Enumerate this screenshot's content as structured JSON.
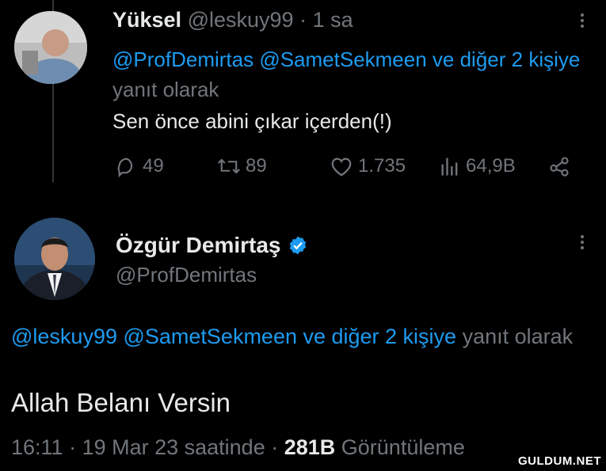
{
  "tweet1": {
    "name": "Yüksel",
    "handle": "@leskuy99",
    "separator": "·",
    "time": "1 sa",
    "replying_mentions": "@ProfDemirtas @SametSekmeen ve diğer 2 kişiye",
    "replying_suffix": "yanıt olarak",
    "body": "Sen önce abini çıkar içerden(!)",
    "replies": "49",
    "retweets": "89",
    "likes": "1.735",
    "views": "64,9B"
  },
  "tweet2": {
    "name": "Özgür Demirtaş",
    "handle": "@ProfDemirtas",
    "replying_mentions": "@leskuy99 @SametSekmeen ve diğer 2 kişiye",
    "replying_suffix": "yanıt olarak",
    "body": "Allah Belanı Versin",
    "timestamp": "16:11 · 19 Mar 23 saatinde ·",
    "views_count": "281B",
    "views_label": "Görüntüleme"
  },
  "watermark": "GULDUM.NET",
  "colors": {
    "accent": "#1d9bf0",
    "muted": "#71767b",
    "text": "#e7e9ea",
    "background": "#000000"
  }
}
